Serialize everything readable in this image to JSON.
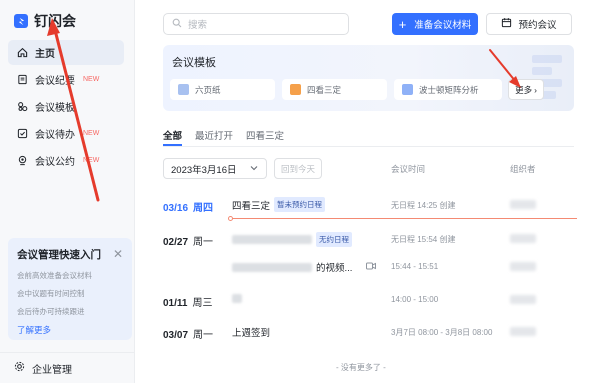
{
  "app": {
    "name": "钉闪会"
  },
  "sidebar": {
    "items": [
      {
        "label": "主页",
        "badge": "",
        "icon": "home-icon"
      },
      {
        "label": "会议纪要",
        "badge": "NEW",
        "icon": "minutes-icon"
      },
      {
        "label": "会议模板",
        "badge": "",
        "icon": "template-icon"
      },
      {
        "label": "会议待办",
        "badge": "NEW",
        "icon": "todo-icon"
      },
      {
        "label": "会议公约",
        "badge": "NEW",
        "icon": "convention-icon"
      }
    ],
    "promo": {
      "title": "会议管理快速入门",
      "lines": [
        "会前高效准备会议材料",
        "会中议题有时间控制",
        "会后待办可持续跟进"
      ],
      "link": "了解更多"
    },
    "footer": "企业管理"
  },
  "toolbar": {
    "search_placeholder": "搜索",
    "prepare_label": "准备会议材料",
    "book_label": "预约会议"
  },
  "templates": {
    "title": "会议模板",
    "items": [
      {
        "label": "六页纸",
        "color": "#a8c1f0"
      },
      {
        "label": "四看三定",
        "color": "#f5a04a"
      },
      {
        "label": "波士顿矩阵分析",
        "color": "#8fb1f7"
      }
    ],
    "more_label": "更多"
  },
  "tabs": [
    "全部",
    "最近打开",
    "四看三定"
  ],
  "filter": {
    "date": "2023年3月16日",
    "today_label": "回到今天"
  },
  "columns": {
    "time": "会议时间",
    "organizer": "组织者"
  },
  "meetings": [
    {
      "date": "03/16",
      "weekday": "周四",
      "today": true,
      "title": "四看三定",
      "tag": "暂未预约日程",
      "time": "无日程 14:25 创建"
    },
    {
      "date": "02/27",
      "weekday": "周一",
      "today": false,
      "title": "",
      "tag": "无约日程",
      "time": "无日程 15:54 创建"
    },
    {
      "date": "",
      "weekday": "",
      "today": false,
      "title": "的视频...",
      "tag": "",
      "time": "15:44 - 15:51"
    },
    {
      "date": "01/11",
      "weekday": "周三",
      "today": false,
      "title": "",
      "tag": "",
      "time": "14:00 - 15:00"
    },
    {
      "date": "03/07",
      "weekday": "周一",
      "today": false,
      "title": "上週签到",
      "tag": "",
      "time": "3月7日 08:00 - 3月8日 08:00"
    }
  ],
  "footer_note": "- 没有更多了 -",
  "colors": {
    "accent": "#3370ff",
    "annotation": "#e53b2c"
  }
}
